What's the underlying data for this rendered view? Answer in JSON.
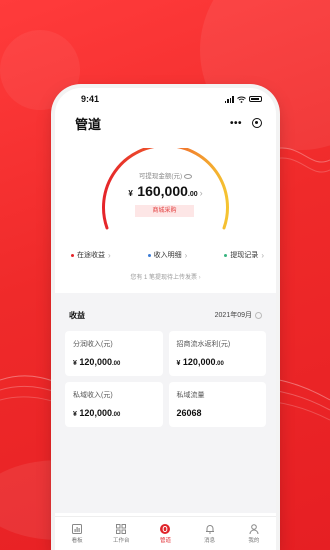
{
  "status": {
    "time": "9:41"
  },
  "nav": {
    "title": "管道"
  },
  "gauge": {
    "label": "可提现金额(元)",
    "currency": "¥",
    "amount_int": "160,000",
    "amount_dec": ".00",
    "action_label": "商城采购"
  },
  "links": [
    {
      "label": "在途收益",
      "color": "#e5242a"
    },
    {
      "label": "收入明细",
      "color": "#3a7bd5"
    },
    {
      "label": "提现记录",
      "color": "#36b37e"
    }
  ],
  "invoice_note": "您有 1 笔提现待上传发票",
  "earnings": {
    "title": "收益",
    "date": "2021年09月",
    "cards": [
      {
        "label": "分润收入(元)",
        "currency": "¥",
        "value": "120,000",
        "dec": ".00"
      },
      {
        "label": "招商流水返利(元)",
        "currency": "¥",
        "value": "120,000",
        "dec": ".00"
      },
      {
        "label": "私域收入(元)",
        "currency": "¥",
        "value": "120,000",
        "dec": ".00"
      },
      {
        "label": "私域流量",
        "currency": "",
        "value": "26068",
        "dec": ""
      }
    ]
  },
  "tabbar": {
    "items": [
      {
        "label": "看板",
        "icon": "chart-icon"
      },
      {
        "label": "工作台",
        "icon": "grid-icon"
      },
      {
        "label": "管道",
        "icon": "pipe-icon"
      },
      {
        "label": "消息",
        "icon": "bell-icon"
      },
      {
        "label": "我的",
        "icon": "person-icon"
      }
    ],
    "active": "管道"
  },
  "colors": {
    "brand": "#e5242a",
    "gauge_start": "#e5242a",
    "gauge_end": "#f5c431"
  }
}
